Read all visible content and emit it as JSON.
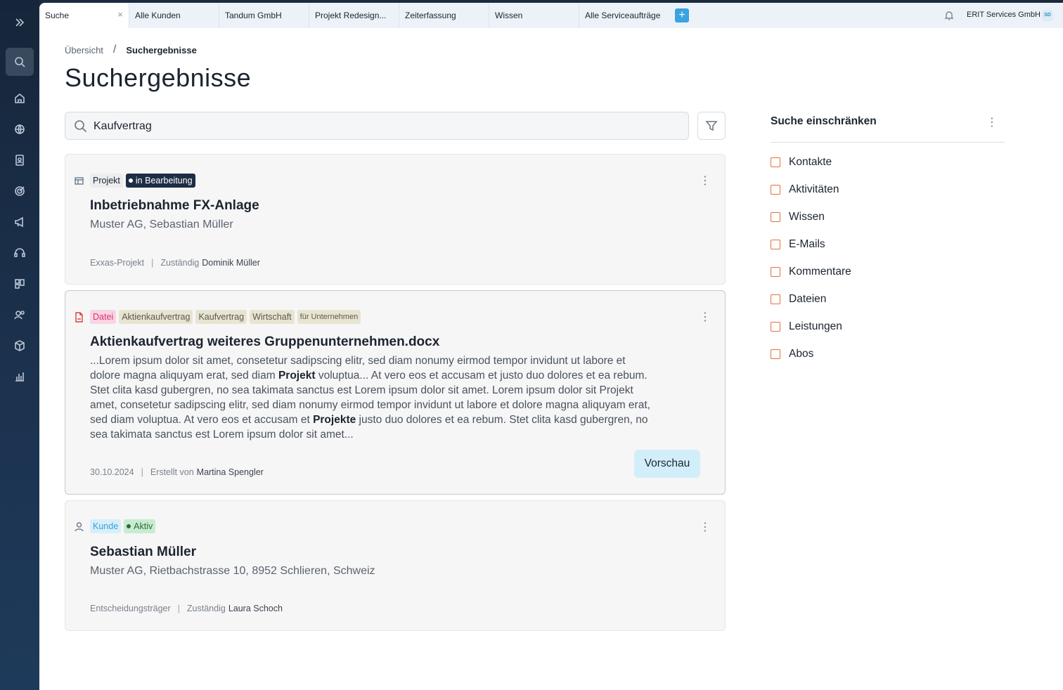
{
  "tabs": [
    {
      "label": "Suche",
      "active": true
    },
    {
      "label": "Alle Kunden"
    },
    {
      "label": "Tandum GmbH"
    },
    {
      "label": "Projekt Redesign..."
    },
    {
      "label": "Zeiterfassung"
    },
    {
      "label": "Wissen"
    },
    {
      "label": "Alle Serviceaufträge"
    }
  ],
  "header": {
    "company": "ERIT Services GmbH",
    "avatar_initials": "SD"
  },
  "breadcrumb": {
    "parent": "Übersicht",
    "separator": "/",
    "current": "Suchergebnisse"
  },
  "page_title": "Suchergebnisse",
  "search": {
    "value": "Kaufvertrag"
  },
  "results": [
    {
      "icon": "project-icon",
      "tags": [
        "Projekt",
        "in Bearbeitung"
      ],
      "title": "Inbetriebnahme FX-Anlage",
      "subtitle": "Muster AG, Sebastian Müller",
      "meta": {
        "left": "Exxas-Projekt",
        "label": "Zuständig",
        "person": "Dominik Müller"
      }
    },
    {
      "icon": "pdf-file-icon",
      "tags": [
        "Datei",
        "Aktienkaufvertrag",
        "Kaufvertrag",
        "Wirtschaft",
        "für Unternehmen"
      ],
      "title": "Aktienkaufvertrag weiteres Gruppenunternehmen.docx",
      "excerpt": [
        {
          "text": "...Lorem ipsum dolor sit amet, consetetur sadipscing elitr, sed diam nonumy eirmod tempor invidunt ut labore et dolore magna aliquyam erat, sed diam "
        },
        {
          "text": "Projekt",
          "bold": true
        },
        {
          "text": " voluptua... At vero eos et accusam et justo duo dolores et ea rebum. Stet clita kasd gubergren, no sea takimata sanctus est Lorem ipsum dolor sit amet. Lorem ipsum dolor sit Projekt amet, consetetur sadipscing elitr, sed diam nonumy eirmod tempor invidunt ut labore et dolore magna aliquyam erat, sed diam voluptua. At vero eos et accusam et "
        },
        {
          "text": "Projekte",
          "bold": true
        },
        {
          "text": " justo duo dolores et ea rebum. Stet clita kasd gubergren, no sea takimata sanctus est Lorem ipsum dolor sit amet..."
        }
      ],
      "meta": {
        "left": "30.10.2024",
        "label": "Erstellt von",
        "person": "Martina Spengler"
      },
      "preview_label": "Vorschau"
    },
    {
      "icon": "person-icon",
      "tags": [
        "Kunde",
        "Aktiv"
      ],
      "title": "Sebastian Müller",
      "subtitle": "Muster AG, Rietbachstrasse 10, 8952 Schlieren, Schweiz",
      "meta": {
        "left": "Entscheidungsträger",
        "label": "Zuständig",
        "person": "Laura Schoch"
      }
    }
  ],
  "filter_panel": {
    "title": "Suche einschränken",
    "options": [
      "Kontakte",
      "Aktivitäten",
      "Wissen",
      "E-Mails",
      "Kommentare",
      "Dateien",
      "Leistungen",
      "Abos"
    ]
  },
  "colors": {
    "accent_blue": "#3aa3e0",
    "sidebar": "#1c3350",
    "checkbox_border": "#e0723a"
  }
}
